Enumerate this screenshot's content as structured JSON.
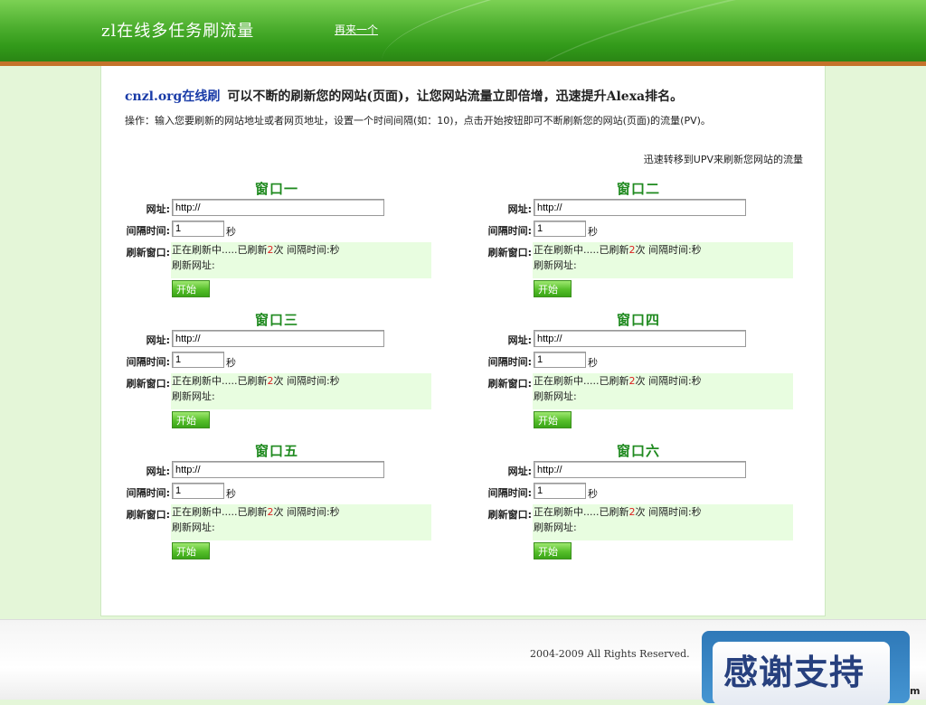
{
  "header": {
    "title": "zl在线多任务刷流量",
    "again_link": "再来一个"
  },
  "intro": {
    "brand": "cnzl.org在线刷",
    "text": "可以不断的刷新您的网站(页面)，让您网站流量立即倍增，迅速提升Alexa排名。"
  },
  "howto": "操作：输入您要刷新的网站地址或者网页地址，设置一个时间间隔(如：10)，点击开始按钮即可不断刷新您的网站(页面)的流量(PV)。",
  "upv_link": "迅速转移到UPV来刷新您网站的流量",
  "labels": {
    "url": "网址:",
    "interval": "间隔时间:",
    "refresh_window": "刷新窗口:",
    "unit": "秒",
    "status_prefix": "正在刷新中.....已刷新",
    "status_suffix": "次  间隔时间:秒",
    "refresh_url": "刷新网址:",
    "start": "开始"
  },
  "windows": [
    {
      "title": "窗口一",
      "url": "http://",
      "interval": "1",
      "count": "2"
    },
    {
      "title": "窗口二",
      "url": "http://",
      "interval": "1",
      "count": "2"
    },
    {
      "title": "窗口三",
      "url": "http://",
      "interval": "1",
      "count": "2"
    },
    {
      "title": "窗口四",
      "url": "http://",
      "interval": "1",
      "count": "2"
    },
    {
      "title": "窗口五",
      "url": "http://",
      "interval": "1",
      "count": "2"
    },
    {
      "title": "窗口六",
      "url": "http://",
      "interval": "1",
      "count": "2"
    }
  ],
  "footer": {
    "copyright": "2004-2009 All Rights Reserved.",
    "thanks": "感谢支持",
    "edge_text": "m"
  }
}
